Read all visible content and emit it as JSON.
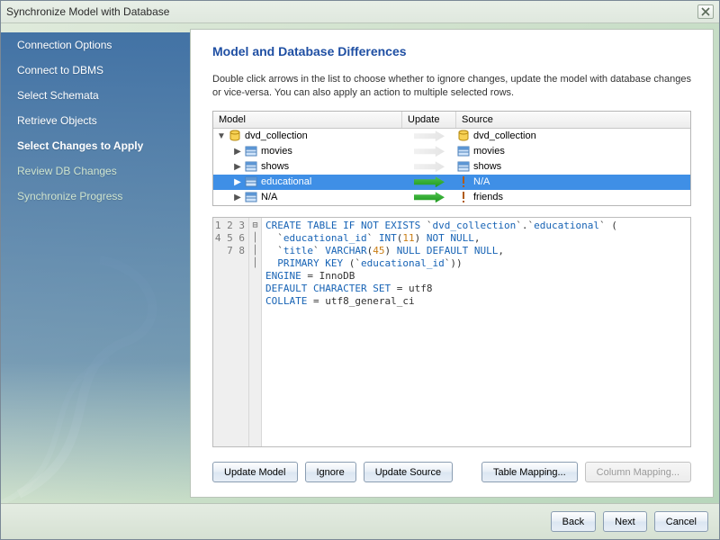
{
  "window": {
    "title": "Synchronize Model with Database"
  },
  "sidebar": {
    "items": [
      {
        "label": "Connection Options",
        "dim": false
      },
      {
        "label": "Connect to DBMS",
        "dim": false
      },
      {
        "label": "Select Schemata",
        "dim": false
      },
      {
        "label": "Retrieve Objects",
        "dim": false
      },
      {
        "label": "Select Changes to Apply",
        "current": true
      },
      {
        "label": "Review DB Changes",
        "dim": true
      },
      {
        "label": "Synchronize Progress",
        "dim": true
      }
    ]
  },
  "heading": "Model and Database Differences",
  "subtext": "Double click arrows in the list to choose whether to ignore changes, update the model with database changes or vice-versa. You can also apply an action to multiple selected rows.",
  "columns": {
    "model": "Model",
    "update": "Update",
    "source": "Source"
  },
  "tree": [
    {
      "indent": 0,
      "expand": "down",
      "icon": "db",
      "model": "dvd_collection",
      "arrow": "faint",
      "srcIcon": "db",
      "source": "dvd_collection",
      "selected": false
    },
    {
      "indent": 1,
      "expand": "right",
      "icon": "table",
      "model": "movies",
      "arrow": "faint",
      "srcIcon": "table",
      "source": "movies",
      "selected": false
    },
    {
      "indent": 1,
      "expand": "right",
      "icon": "table",
      "model": "shows",
      "arrow": "faint",
      "srcIcon": "table",
      "source": "shows",
      "selected": false
    },
    {
      "indent": 1,
      "expand": "right",
      "icon": "table",
      "model": "educational",
      "arrow": "green",
      "srcIcon": "warn",
      "source": "N/A",
      "selected": true
    },
    {
      "indent": 1,
      "expand": "right",
      "icon": "table",
      "model": "N/A",
      "arrow": "green",
      "srcIcon": "warn",
      "source": "friends",
      "selected": false
    }
  ],
  "sql": {
    "lines": [
      1,
      2,
      3,
      4,
      5,
      6,
      7,
      8
    ],
    "text": "CREATE TABLE IF NOT EXISTS `dvd_collection`.`educational` (\n  `educational_id` INT(11) NOT NULL,\n  `title` VARCHAR(45) NULL DEFAULT NULL,\n  PRIMARY KEY (`educational_id`))\nENGINE = InnoDB\nDEFAULT CHARACTER SET = utf8\nCOLLATE = utf8_general_ci\n"
  },
  "buttons": {
    "update_model": "Update Model",
    "ignore": "Ignore",
    "update_source": "Update Source",
    "table_mapping": "Table Mapping...",
    "column_mapping": "Column Mapping..."
  },
  "footer": {
    "back": "Back",
    "next": "Next",
    "cancel": "Cancel"
  }
}
